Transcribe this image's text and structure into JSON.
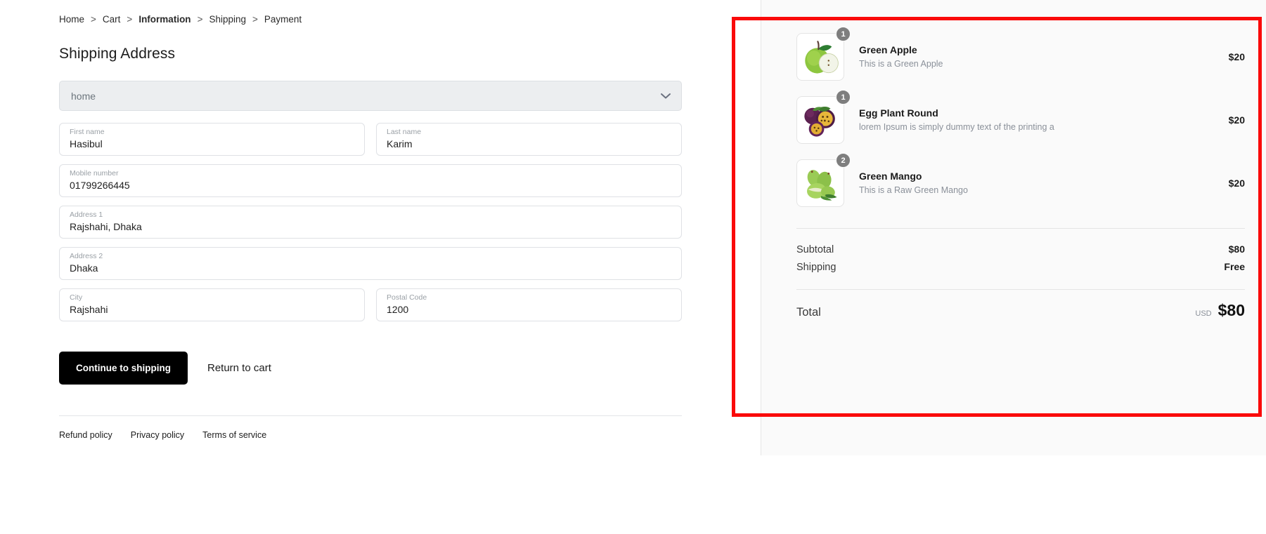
{
  "breadcrumb": {
    "separator": ">",
    "items": [
      {
        "label": "Home",
        "current": false
      },
      {
        "label": "Cart",
        "current": false
      },
      {
        "label": "Information",
        "current": true
      },
      {
        "label": "Shipping",
        "current": false
      },
      {
        "label": "Payment",
        "current": false
      }
    ]
  },
  "shipping_form": {
    "title": "Shipping Address",
    "address_select": {
      "selected": "home",
      "options": [
        "home"
      ]
    },
    "fields": [
      {
        "label": "First name",
        "value": "Hasibul"
      },
      {
        "label": "Last name",
        "value": "Karim"
      },
      {
        "label": "Mobile number",
        "value": "01799266445"
      },
      {
        "label": "Address 1",
        "value": "Rajshahi, Dhaka"
      },
      {
        "label": "Address 2",
        "value": "Dhaka"
      },
      {
        "label": "City",
        "value": "Rajshahi"
      },
      {
        "label": "Postal Code",
        "value": "1200"
      }
    ],
    "primary_button": "Continue to shipping",
    "secondary_button": "Return to cart"
  },
  "footer": {
    "links": [
      "Refund policy",
      "Privacy policy",
      "Terms of service"
    ]
  },
  "order_summary": {
    "items": [
      {
        "name": "Green Apple",
        "description": "This is a Green Apple",
        "price": "$20",
        "quantity": "1",
        "image": "green-apple-image"
      },
      {
        "name": "Egg Plant Round",
        "description": "lorem Ipsum is simply dummy text of the printing a",
        "price": "$20",
        "quantity": "1",
        "image": "passion-fruit-image"
      },
      {
        "name": "Green Mango",
        "description": "This is a Raw Green Mango",
        "price": "$20",
        "quantity": "2",
        "image": "green-mango-image"
      }
    ],
    "subtotal_label": "Subtotal",
    "subtotal_value": "$80",
    "shipping_label": "Shipping",
    "shipping_value": "Free",
    "total_label": "Total",
    "total_currency": "USD",
    "total_value": "$80"
  },
  "annotation": {
    "color": "#fa0a0a"
  }
}
